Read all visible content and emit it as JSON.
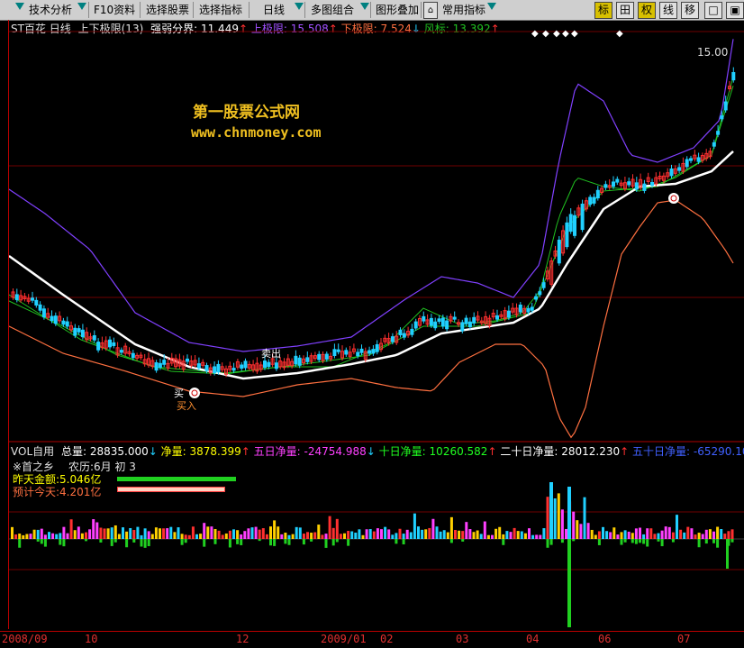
{
  "toolbar": {
    "items": [
      "技术分析",
      "F10资料",
      "选择股票",
      "选择指标",
      "日线",
      "多图组合",
      "图形叠加",
      "常用指标"
    ],
    "right_buttons": [
      "标",
      "田",
      "权",
      "线",
      "移",
      "□",
      "▣"
    ]
  },
  "main_header": {
    "stock": "ST百花",
    "period": "日线",
    "indicator": "上下极限(13)",
    "weak_label": "强弱分界:",
    "weak_value": "11.449",
    "upper_label": "上极限:",
    "upper_value": "15.508",
    "lower_label": "下极限:",
    "lower_value": "7.524",
    "wind_label": "风标:",
    "wind_value": "13.392"
  },
  "price_max_label": "15.00",
  "watermark": {
    "line1": "第一股票公式网",
    "line2": "www.chnmoney.com"
  },
  "signals": {
    "buy": "买入",
    "sell": "卖出",
    "buy2": "买"
  },
  "vol_header": {
    "name": "VOL自用",
    "total_label": "总量:",
    "total_value": "28835.000",
    "net_label": "净量:",
    "net_value": "3878.399",
    "net5_label": "五日净量:",
    "net5_value": "-24754.988",
    "net10_label": "十日净量:",
    "net10_value": "10260.582",
    "net20_label": "二十日净量:",
    "net20_value": "28012.230",
    "net50_label": "五十日净量:",
    "net50_value": "-65290.105"
  },
  "info": {
    "shou": "※首之乡",
    "lunar": "农历:6月 初 3",
    "yesterday_label": "昨天金额:",
    "yesterday_value": "5.046亿",
    "today_label": "预计今天:",
    "today_value": "4.201亿"
  },
  "x_labels": [
    "2008/09",
    "10",
    "12",
    "2009/01",
    "02",
    "03",
    "04",
    "06",
    "07"
  ],
  "colors": {
    "up": "#ff3030",
    "down": "#20d0ff",
    "ma_white": "#ffffff",
    "upper_band": "#8040ff",
    "lower_band": "#ff7040",
    "mid_line": "#20c020"
  }
}
